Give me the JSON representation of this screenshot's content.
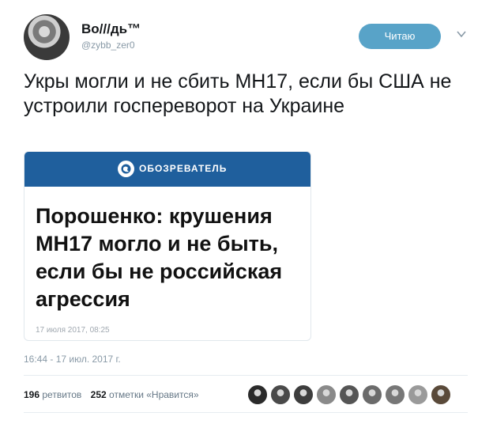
{
  "user": {
    "display_name": "Во///дь™",
    "username": "@zybb_zer0"
  },
  "follow_button": {
    "label": "Читаю"
  },
  "tweet": {
    "text": "Укры могли и не сбить МН17, если бы США не устроили госпереворот на Украине",
    "timestamp": "16:44 - 17 июл. 2017 г."
  },
  "card": {
    "source_name": "ОБОЗРЕВАТЕЛЬ",
    "headline": "Порошенко: крушения МН17 могло и не быть, если бы не российская агрессия",
    "date": "17 июля 2017, 08:25",
    "header_color": "#1f5f9d"
  },
  "stats": {
    "retweets_count": "196",
    "retweets_label": "ретвитов",
    "likes_count": "252",
    "likes_label": "отметки «Нравится»"
  },
  "likers": {
    "count_shown": 9,
    "avatar_colors": [
      "#2b2b2b",
      "#4a4a4a",
      "#3d3d3d",
      "#8a8a8a",
      "#555555",
      "#6b6b6b",
      "#777777",
      "#9a9a9a",
      "#5a4a3a"
    ]
  },
  "colors": {
    "follow_button": "#58a3c8",
    "muted_text": "#8899a6"
  },
  "icons": {
    "chevron": "chevron-down-icon",
    "card_logo": "globe-logo-icon"
  }
}
